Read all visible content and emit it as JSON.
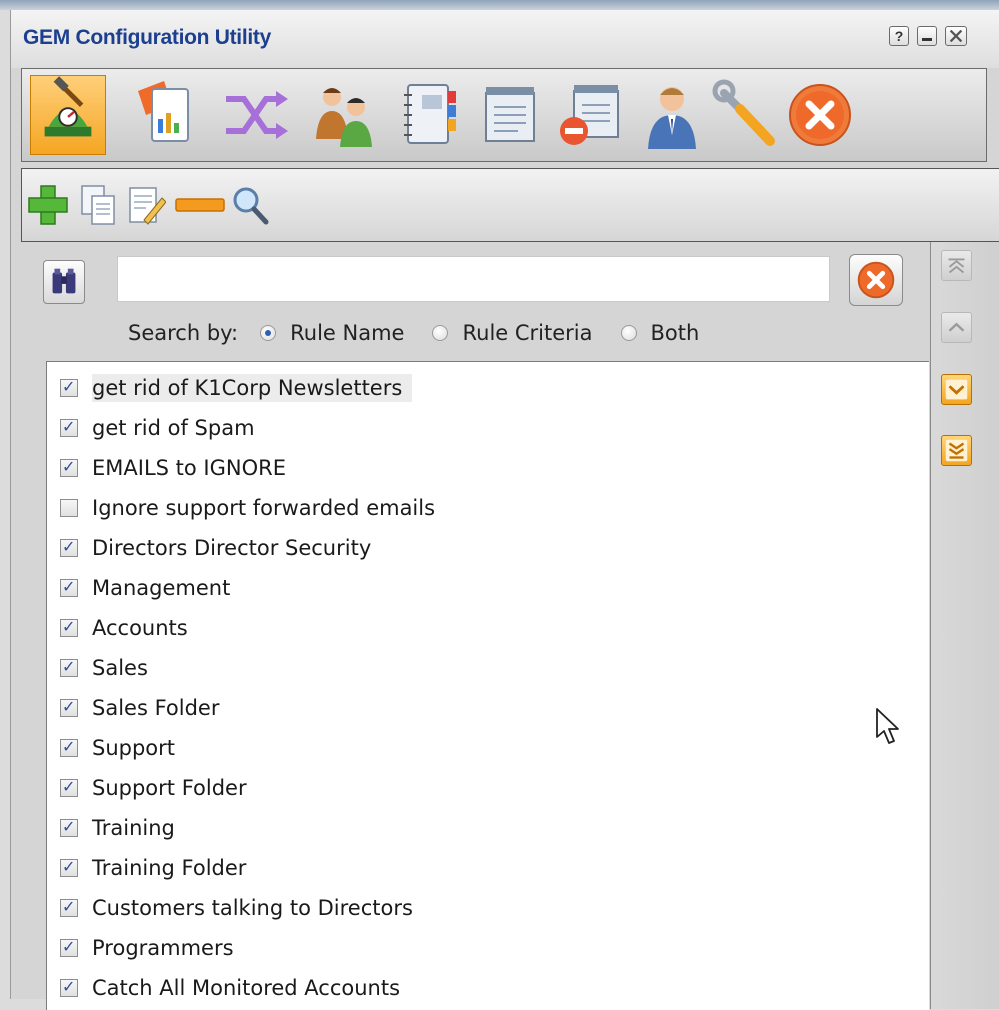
{
  "window": {
    "title": "GEM Configuration Utility",
    "help_label": "?"
  },
  "main_toolbar": {
    "icons": [
      "setup-wizard-icon",
      "report-icon",
      "shuffle-icon",
      "users-icon",
      "address-book-icon",
      "notepad-icon",
      "remove-notepad-icon",
      "user-icon",
      "wrench-icon",
      "exit-icon"
    ],
    "active_index": 0
  },
  "sub_toolbar": {
    "icons": [
      "add-icon",
      "copy-icon",
      "edit-icon",
      "remove-icon",
      "search-icon"
    ]
  },
  "search": {
    "value": "",
    "prefix": "Search by:",
    "options": [
      {
        "label": "Rule Name",
        "selected": true
      },
      {
        "label": "Rule Criteria",
        "selected": false
      },
      {
        "label": "Both",
        "selected": false
      }
    ]
  },
  "rules": [
    {
      "label": "get rid of K1Corp Newsletters",
      "checked": true
    },
    {
      "label": "get rid of Spam",
      "checked": true
    },
    {
      "label": "EMAILS to IGNORE",
      "checked": true
    },
    {
      "label": "Ignore support forwarded emails",
      "checked": false
    },
    {
      "label": "Directors Director Security",
      "checked": true
    },
    {
      "label": "Management",
      "checked": true
    },
    {
      "label": "Accounts",
      "checked": true
    },
    {
      "label": "Sales",
      "checked": true
    },
    {
      "label": "Sales Folder",
      "checked": true
    },
    {
      "label": "Support",
      "checked": true
    },
    {
      "label": "Support Folder",
      "checked": true
    },
    {
      "label": "Training",
      "checked": true
    },
    {
      "label": "Training Folder",
      "checked": true
    },
    {
      "label": "Customers talking to Directors",
      "checked": true
    },
    {
      "label": "Programmers",
      "checked": true
    },
    {
      "label": "Catch All Monitored Accounts",
      "checked": true
    }
  ],
  "selected_rule_index": 0,
  "colors": {
    "title": "#1d3f8f",
    "accent_orange": "#f3a521",
    "check": "#2e4f93"
  }
}
